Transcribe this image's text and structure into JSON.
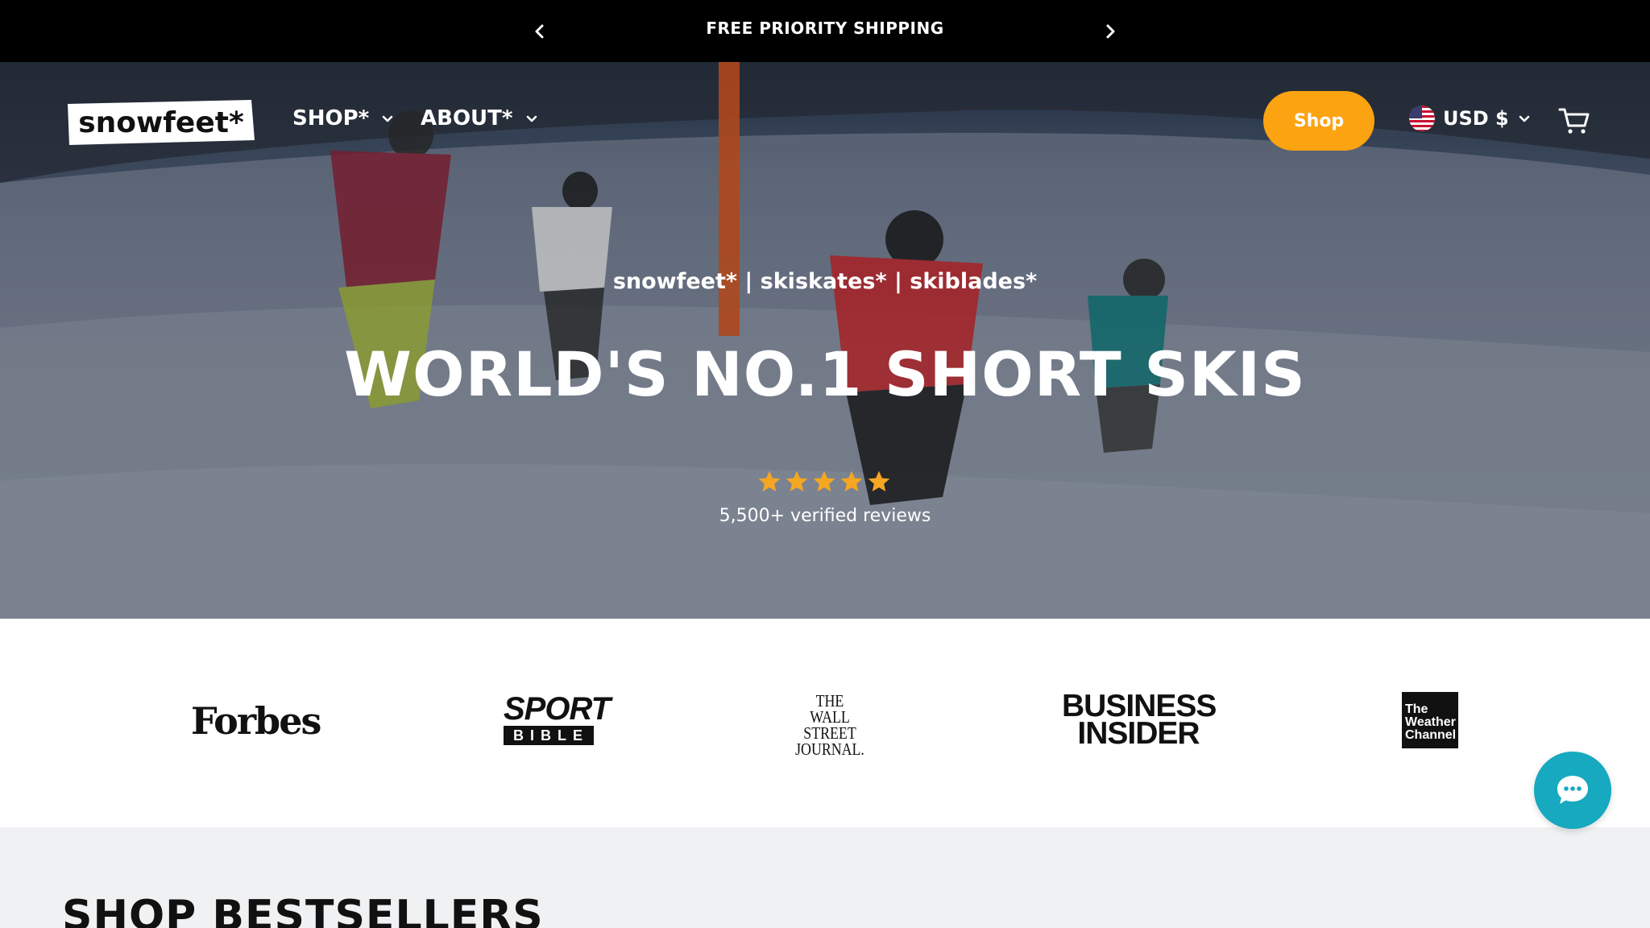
{
  "announcement": {
    "text": "FREE PRIORITY SHIPPING",
    "prev_icon": "chevron-left-icon",
    "next_icon": "chevron-right-icon"
  },
  "header": {
    "logo_text": "snowfeet*",
    "nav": [
      {
        "label": "SHOP*",
        "icon": "chevron-down-icon"
      },
      {
        "label": "ABOUT*",
        "icon": "chevron-down-icon"
      }
    ],
    "shop_button": "Shop",
    "currency": {
      "label": "USD $",
      "flag_icon": "us-flag-icon",
      "icon": "chevron-down-icon"
    },
    "cart_icon": "cart-icon"
  },
  "hero": {
    "tagline": "snowfeet* | skiskates* | skiblades*",
    "headline": "WORLD'S NO.1 SHORT SKIS",
    "rating": {
      "stars": 5,
      "max": 5,
      "star_color": "#f5a623"
    },
    "reviews": "5,500+ verified reviews"
  },
  "press": {
    "forbes": "Forbes",
    "sport_top": "SPORT",
    "sport_bottom": "BIBLE",
    "wsj": [
      "THE",
      "WALL STREET",
      "JOURNAL."
    ],
    "bi": [
      "BUSINESS",
      "INSIDER"
    ],
    "twc": [
      "The",
      "Weather",
      "Channel"
    ]
  },
  "chat": {
    "icon": "chat-bubble-icon"
  },
  "bestsellers": {
    "title": "SHOP BESTSELLERS"
  },
  "colors": {
    "accent": "#fca311",
    "chat": "#16a9bf",
    "announcement_bg": "#000000",
    "section_bg": "#f0f1f3"
  }
}
